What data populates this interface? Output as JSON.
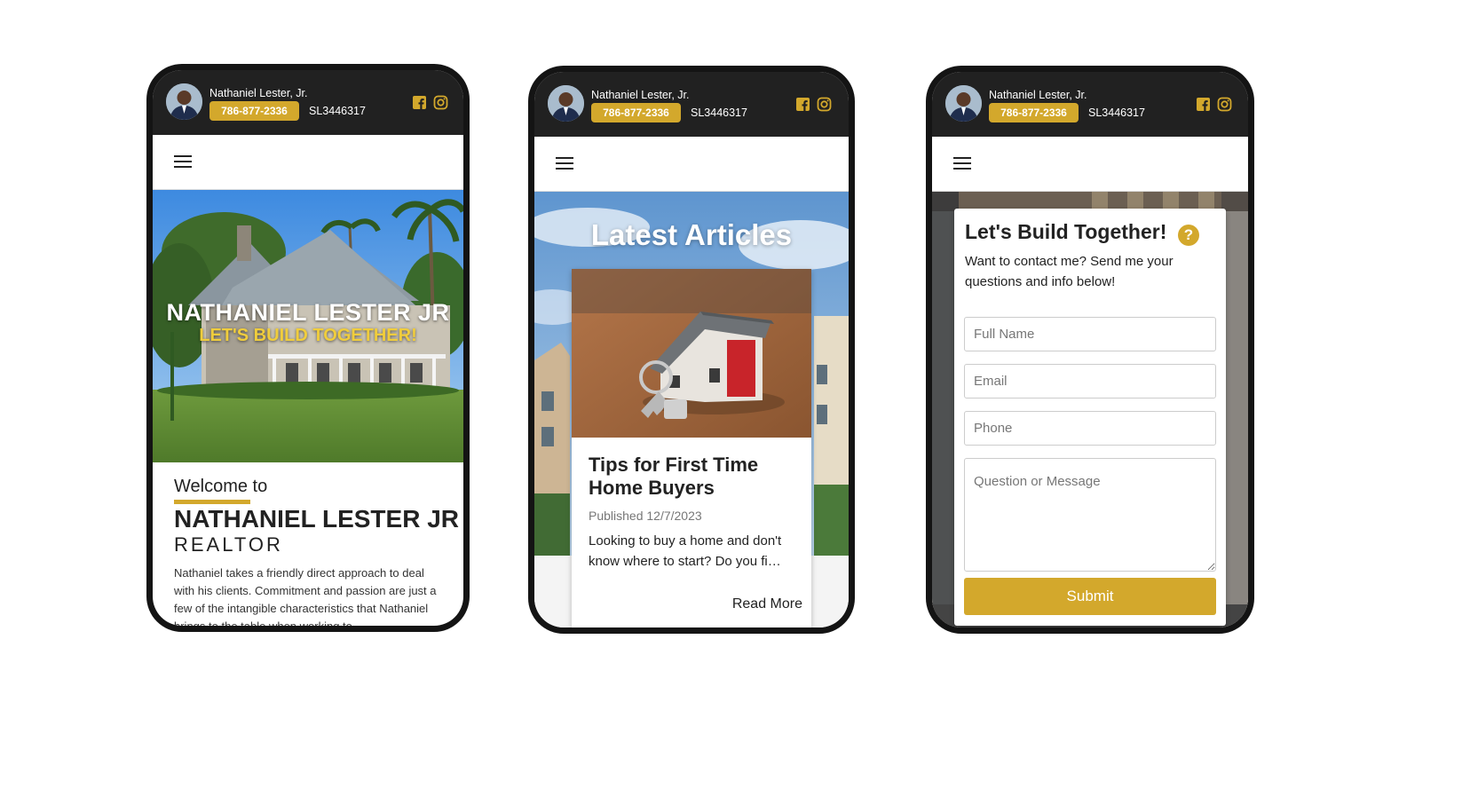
{
  "header": {
    "agent_name": "Nathaniel Lester, Jr.",
    "phone_number": "786-877-2336",
    "license": "SL3446317",
    "icons": [
      "avatar-photo",
      "facebook-icon",
      "instagram-icon"
    ]
  },
  "nav": {
    "icon": "hamburger-menu-icon"
  },
  "home": {
    "hero_name": "NATHANIEL LESTER JR",
    "hero_tagline": "LET'S BUILD TOGETHER!",
    "welcome": "Welcome to",
    "name": "NATHANIEL LESTER JR",
    "title": "REALTOR",
    "bio": "Nathaniel takes a friendly direct approach to deal with his clients. Commitment and passion are just a few of the intangible characteristics that Nathaniel brings to the table when working to"
  },
  "articles": {
    "heading": "Latest Articles",
    "card": {
      "title": "Tips for First Time Home Buyers",
      "published": "Published 12/7/2023",
      "excerpt": "Looking to buy a home and don't know where to start? Do you fi…",
      "read_more": "Read More"
    }
  },
  "contact": {
    "title": "Let's Build Together!",
    "help_icon": "?",
    "intro": "Want to contact me? Send me your questions and info below!",
    "fields": {
      "full_name": "Full Name",
      "email": "Email",
      "phone": "Phone",
      "message": "Question or Message"
    },
    "submit": "Submit"
  },
  "colors": {
    "accent": "#d3a82c",
    "topbar": "#212121",
    "frame": "#141414"
  }
}
